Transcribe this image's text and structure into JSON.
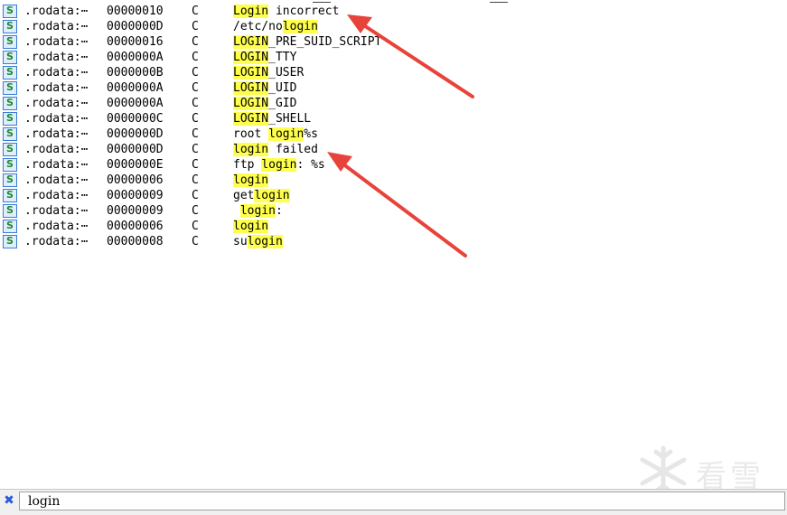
{
  "rows": [
    {
      "segment": ".rodata:⋯",
      "length": "00000010",
      "type": "C",
      "parts": [
        [
          "Login",
          true
        ],
        [
          " incorrect",
          false
        ]
      ]
    },
    {
      "segment": ".rodata:⋯",
      "length": "0000000D",
      "type": "C",
      "parts": [
        [
          "/etc/no",
          false
        ],
        [
          "login",
          true
        ]
      ]
    },
    {
      "segment": ".rodata:⋯",
      "length": "00000016",
      "type": "C",
      "parts": [
        [
          "LOGIN",
          true
        ],
        [
          "_PRE_SUID_SCRIPT",
          false
        ]
      ]
    },
    {
      "segment": ".rodata:⋯",
      "length": "0000000A",
      "type": "C",
      "parts": [
        [
          "LOGIN",
          true
        ],
        [
          "_TTY",
          false
        ]
      ]
    },
    {
      "segment": ".rodata:⋯",
      "length": "0000000B",
      "type": "C",
      "parts": [
        [
          "LOGIN",
          true
        ],
        [
          "_USER",
          false
        ]
      ]
    },
    {
      "segment": ".rodata:⋯",
      "length": "0000000A",
      "type": "C",
      "parts": [
        [
          "LOGIN",
          true
        ],
        [
          "_UID",
          false
        ]
      ]
    },
    {
      "segment": ".rodata:⋯",
      "length": "0000000A",
      "type": "C",
      "parts": [
        [
          "LOGIN",
          true
        ],
        [
          "_GID",
          false
        ]
      ]
    },
    {
      "segment": ".rodata:⋯",
      "length": "0000000C",
      "type": "C",
      "parts": [
        [
          "LOGIN",
          true
        ],
        [
          "_SHELL",
          false
        ]
      ]
    },
    {
      "segment": ".rodata:⋯",
      "length": "0000000D",
      "type": "C",
      "parts": [
        [
          "root ",
          false
        ],
        [
          "login",
          true
        ],
        [
          "%s",
          false
        ]
      ]
    },
    {
      "segment": ".rodata:⋯",
      "length": "0000000D",
      "type": "C",
      "parts": [
        [
          "login",
          true
        ],
        [
          " failed",
          false
        ]
      ]
    },
    {
      "segment": ".rodata:⋯",
      "length": "0000000E",
      "type": "C",
      "parts": [
        [
          "ftp ",
          false
        ],
        [
          "login",
          true
        ],
        [
          ": %s",
          false
        ]
      ]
    },
    {
      "segment": ".rodata:⋯",
      "length": "00000006",
      "type": "C",
      "parts": [
        [
          "login",
          true
        ]
      ]
    },
    {
      "segment": ".rodata:⋯",
      "length": "00000009",
      "type": "C",
      "parts": [
        [
          "get",
          false
        ],
        [
          "login",
          true
        ]
      ]
    },
    {
      "segment": ".rodata:⋯",
      "length": "00000009",
      "type": "C",
      "parts": [
        [
          " ",
          false
        ],
        [
          "login",
          true
        ],
        [
          ":",
          false
        ]
      ]
    },
    {
      "segment": ".rodata:⋯",
      "length": "00000006",
      "type": "C",
      "parts": [
        [
          "login",
          true
        ]
      ]
    },
    {
      "segment": ".rodata:⋯",
      "length": "00000008",
      "type": "C",
      "parts": [
        [
          "su",
          false
        ],
        [
          "login",
          true
        ]
      ]
    }
  ],
  "search": {
    "value": "login"
  },
  "watermark": {
    "text": "看雪"
  },
  "colors": {
    "highlight": "#ffff4d",
    "arrow": "#e8433a"
  },
  "icons": {
    "row": "string-s-icon",
    "close": "close-x-icon"
  }
}
